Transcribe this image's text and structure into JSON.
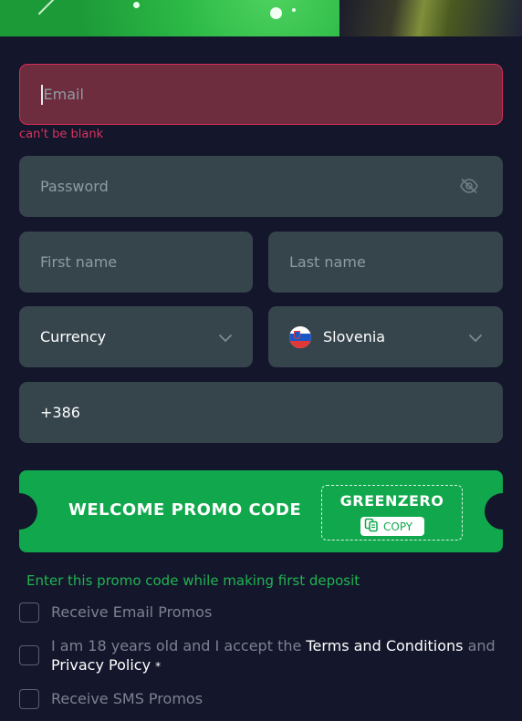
{
  "form": {
    "email": {
      "placeholder": "Email",
      "error": "can't be blank"
    },
    "password": {
      "placeholder": "Password"
    },
    "first_name": {
      "placeholder": "First name"
    },
    "last_name": {
      "placeholder": "Last name"
    },
    "currency": {
      "label": "Currency"
    },
    "country": {
      "value": "Slovenia",
      "flag": "slovenia-flag"
    },
    "phone": {
      "value": "+386"
    }
  },
  "promo": {
    "title": "WELCOME PROMO CODE",
    "code": "GREENZERO",
    "copy_label": "COPY",
    "hint": "Enter this promo code while making first deposit",
    "accent_color": "#11a84d"
  },
  "checkboxes": {
    "email_promos": "Receive Email Promos",
    "terms_prefix": "I am 18 years old and I accept the",
    "terms_link": "Terms and Conditions",
    "terms_and": "and",
    "privacy_link": "Privacy Policy",
    "required_mark": "*",
    "sms_promos": "Receive SMS Promos"
  },
  "colors": {
    "background": "#14162b",
    "field": "#36454c",
    "error": "#d52b56"
  }
}
